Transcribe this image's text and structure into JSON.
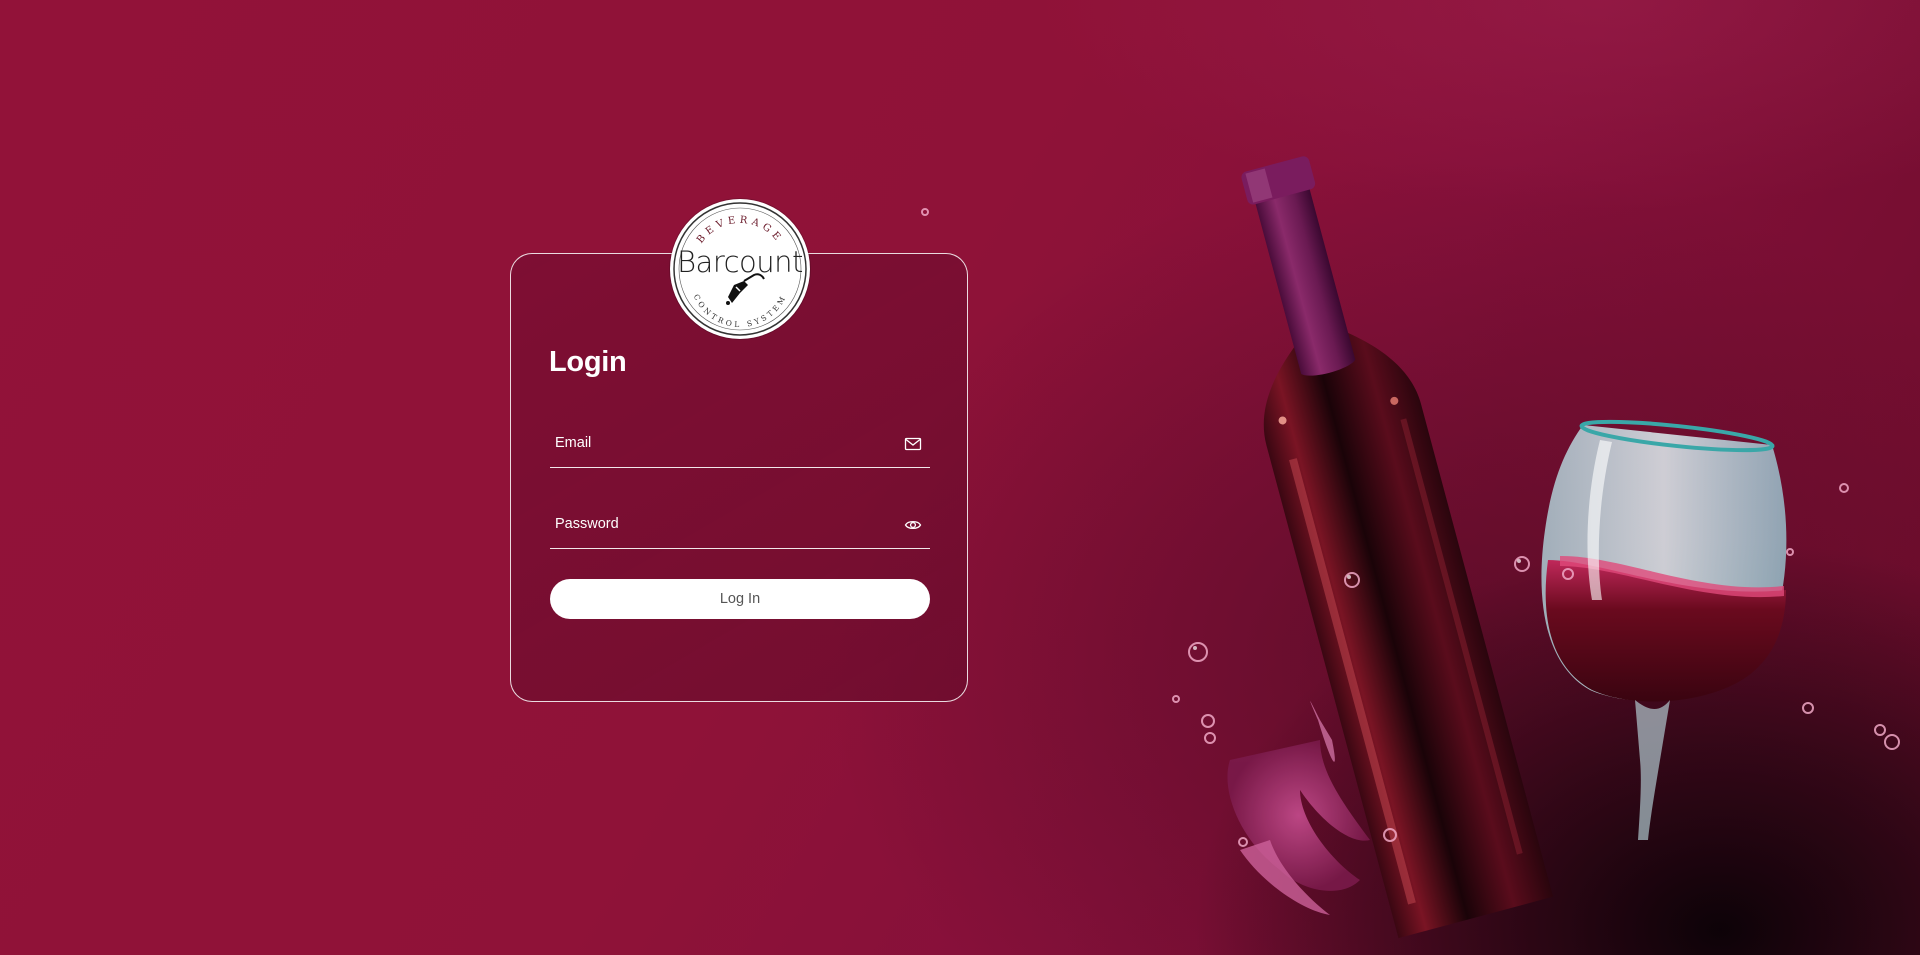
{
  "logo": {
    "top_text": "BEVERAGE",
    "wordmark": "Barcount",
    "bottom_text": "CONTROL SYSTEM"
  },
  "login": {
    "title": "Login",
    "email_placeholder": "Email",
    "email_icon": "envelope-icon",
    "password_placeholder": "Password",
    "password_icon": "eye-icon",
    "button_label": "Log In"
  },
  "colors": {
    "background": "#921239",
    "card_border": "#ffffff",
    "button_bg": "#ffffff",
    "button_text": "#555555"
  },
  "background_art": [
    "wine-bottle",
    "wine-glass",
    "wine-splash",
    "bubbles"
  ]
}
